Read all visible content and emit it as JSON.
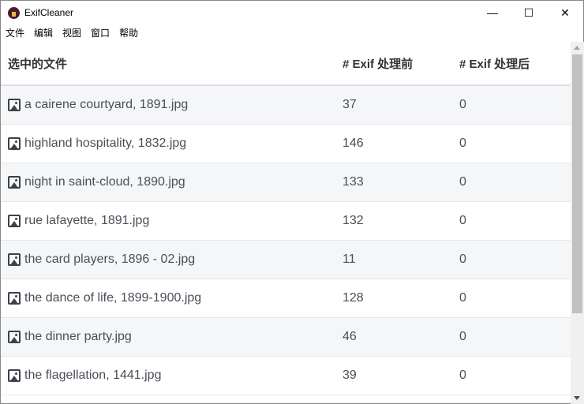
{
  "window": {
    "title": "ExifCleaner",
    "minimize": "—",
    "maximize": "☐",
    "close": "✕"
  },
  "menu": [
    "文件",
    "编辑",
    "视图",
    "窗口",
    "帮助"
  ],
  "table": {
    "headers": [
      "选中的文件",
      "# Exif 处理前",
      "# Exif 处理后"
    ],
    "rows": [
      {
        "file": "a cairene courtyard, 1891.jpg",
        "before": "37",
        "after": "0"
      },
      {
        "file": "highland hospitality, 1832.jpg",
        "before": "146",
        "after": "0"
      },
      {
        "file": "night in saint-cloud, 1890.jpg",
        "before": "133",
        "after": "0"
      },
      {
        "file": "rue lafayette, 1891.jpg",
        "before": "132",
        "after": "0"
      },
      {
        "file": "the card players, 1896 - 02.jpg",
        "before": "11",
        "after": "0"
      },
      {
        "file": "the dance of life, 1899-1900.jpg",
        "before": "128",
        "after": "0"
      },
      {
        "file": "the dinner party.jpg",
        "before": "46",
        "after": "0"
      },
      {
        "file": "the flagellation, 1441.jpg",
        "before": "39",
        "after": "0"
      }
    ]
  }
}
